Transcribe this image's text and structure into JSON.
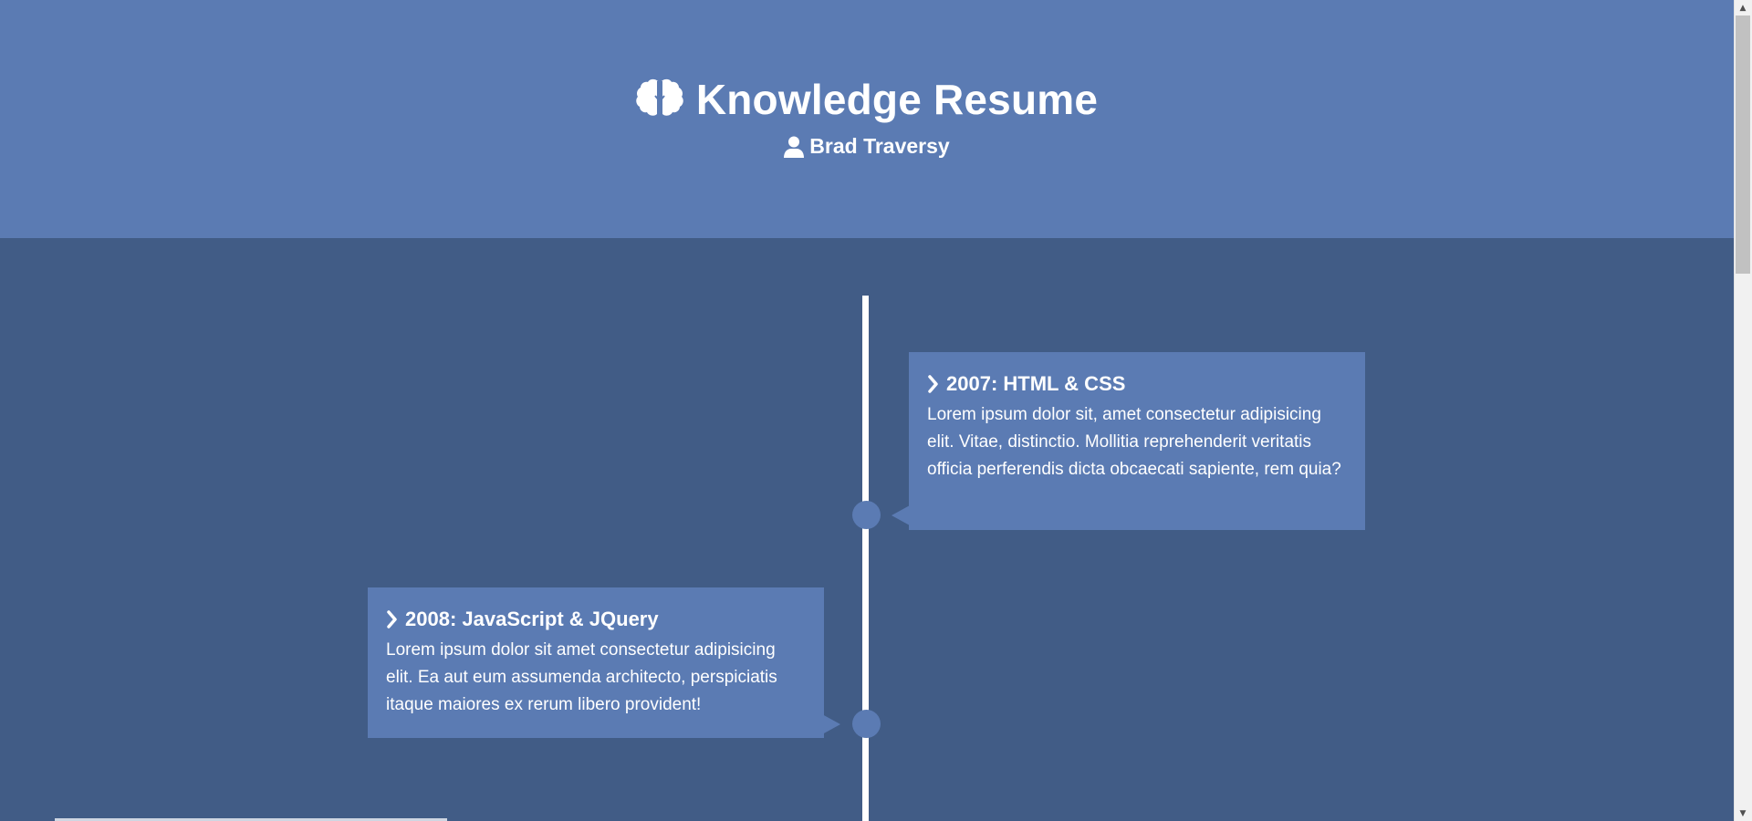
{
  "header": {
    "title": "Knowledge Resume",
    "subtitle": "Brad Traversy",
    "title_icon": "brain-icon",
    "subtitle_icon": "user-icon"
  },
  "timeline": {
    "entries": [
      {
        "heading": "2007: HTML & CSS",
        "body": "Lorem ipsum dolor sit, amet consectetur adipisicing elit. Vitae, distinctio. Mollitia reprehenderit veritatis officia perferendis dicta obcaecati sapiente, rem quia?",
        "side": "right",
        "icon": "chevron-right-icon"
      },
      {
        "heading": "2008: JavaScript & JQuery",
        "body": "Lorem ipsum dolor sit amet consectetur adipisicing elit. Ea aut eum assumenda architecto, perspiciatis itaque maiores ex rerum libero provident!",
        "side": "left",
        "icon": "chevron-right-icon"
      }
    ]
  },
  "colors": {
    "header_bg": "#5b7bb3",
    "page_bg": "#415c86",
    "card_bg": "#5b7bb3",
    "line": "#ffffff",
    "text": "#ffffff"
  },
  "scrollbar": {
    "up_icon": "arrow-up-icon",
    "down_icon": "arrow-down-icon"
  }
}
